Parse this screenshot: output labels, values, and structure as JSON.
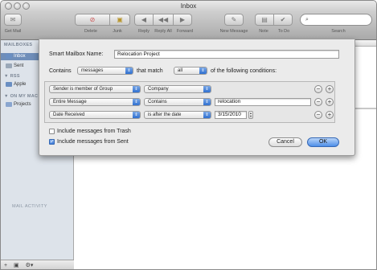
{
  "window": {
    "title": "Inbox"
  },
  "toolbar": {
    "items": [
      "Get Mail",
      "Delete",
      "Junk",
      "Reply",
      "Reply All",
      "Forward",
      "New Message",
      "Note",
      "To Do",
      "Search"
    ]
  },
  "sidebar": {
    "mailboxes_head": "MAILBOXES",
    "item_inbox": "Inbox",
    "item_sent": "Sent",
    "rss_head": "RSS",
    "item_apple": "Apple",
    "onmy_head": "ON MY MAC",
    "item_projects": "Projects",
    "activity": "MAIL ACTIVITY"
  },
  "dialog": {
    "name_label": "Smart Mailbox Name:",
    "name_value": "Relocation Project",
    "contains_label": "Contains",
    "contains_value": "messages",
    "match_label": "that match",
    "match_value": "all",
    "conditions_label": "of the following conditions:",
    "rules": [
      {
        "field": "Sender is member of Group",
        "op": "Company",
        "value": ""
      },
      {
        "field": "Entire Message",
        "op": "Contains",
        "value": "relocation"
      },
      {
        "field": "Date Received",
        "op": "is after the date",
        "value": "3/15/2010"
      }
    ],
    "include_trash": "Include messages from Trash",
    "include_trash_checked": false,
    "include_sent": "Include messages from Sent",
    "include_sent_checked": true,
    "cancel": "Cancel",
    "ok": "OK"
  }
}
